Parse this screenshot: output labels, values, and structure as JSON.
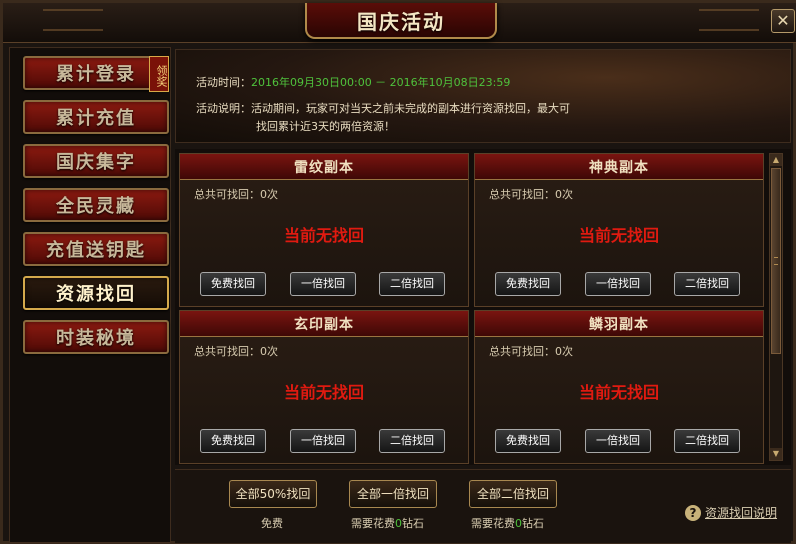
{
  "window": {
    "title": "国庆活动",
    "close_label": "✕"
  },
  "sidebar": {
    "claim_badge": "领奖",
    "items": [
      {
        "label": "累计登录"
      },
      {
        "label": "累计充值"
      },
      {
        "label": "国庆集字"
      },
      {
        "label": "全民灵藏"
      },
      {
        "label": "充值送钥匙"
      },
      {
        "label": "资源找回"
      },
      {
        "label": "时装秘境"
      }
    ]
  },
  "info": {
    "time_label": "活动时间：",
    "time_value": "2016年09月30日00:00 － 2016年10月08日23:59",
    "desc_label": "活动说明：",
    "desc_line1": "活动期间，玩家可对当天之前未完成的副本进行资源找回，最大可",
    "desc_line2": "找回累计近3天的两倍资源！"
  },
  "dungeons": [
    {
      "name": "雷纹副本",
      "count": "总共可找回：0次",
      "status": "当前无找回",
      "btn_free": "免费找回",
      "btn_single": "一倍找回",
      "btn_double": "二倍找回"
    },
    {
      "name": "神典副本",
      "count": "总共可找回：0次",
      "status": "当前无找回",
      "btn_free": "免费找回",
      "btn_single": "一倍找回",
      "btn_double": "二倍找回"
    },
    {
      "name": "玄印副本",
      "count": "总共可找回：0次",
      "status": "当前无找回",
      "btn_free": "免费找回",
      "btn_single": "一倍找回",
      "btn_double": "二倍找回"
    },
    {
      "name": "鳞羽副本",
      "count": "总共可找回：0次",
      "status": "当前无找回",
      "btn_free": "免费找回",
      "btn_single": "一倍找回",
      "btn_double": "二倍找回"
    }
  ],
  "footer": {
    "all_half_label": "全部50%找回",
    "all_half_cost": "免费",
    "all_single_label": "全部一倍找回",
    "all_single_cost_prefix": "需要花费",
    "all_single_cost_value": "0",
    "all_single_cost_suffix": "钻石",
    "all_double_label": "全部二倍找回",
    "all_double_cost_prefix": "需要花费",
    "all_double_cost_value": "0",
    "all_double_cost_suffix": "钻石",
    "help_icon": "?",
    "help_label": "资源找回说明"
  },
  "colors": {
    "accent_red": "#e01a10",
    "highlight_green": "#4fc23c",
    "gold_border": "#d4a94c"
  }
}
